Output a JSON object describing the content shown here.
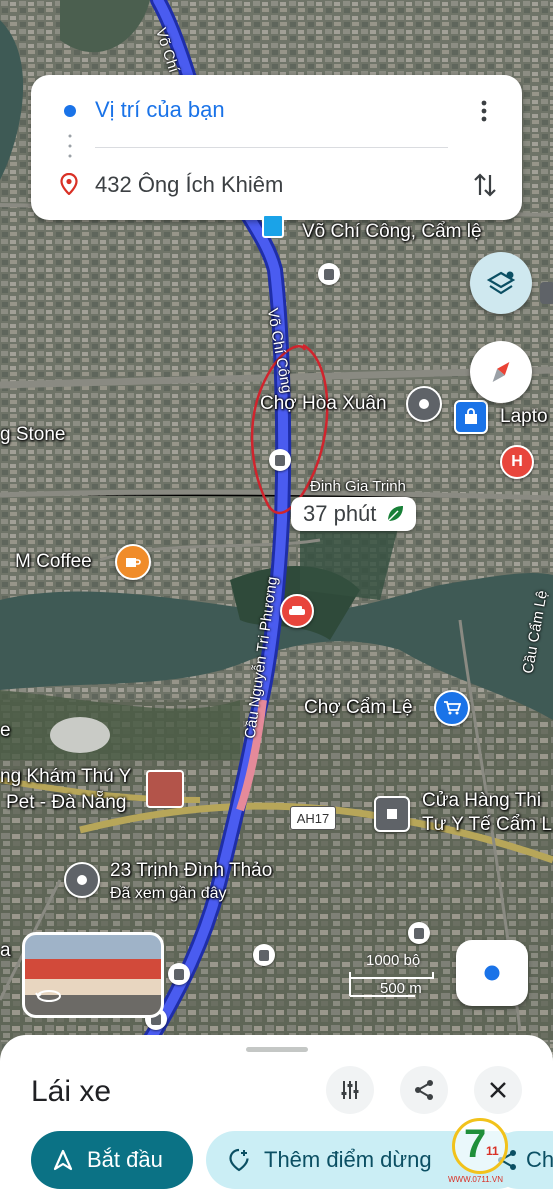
{
  "route_card": {
    "origin": "Vị trí của bạn",
    "destination": "432 Ông Ích Khiêm"
  },
  "map": {
    "labels": {
      "vo_chi_cong_cam_le": "Võ Chí Công, Cẩm lệ",
      "vo_chi_cong_road_top": "Võ Chí Công",
      "vo_chi_cong_road_mid": "Võ Chí Công",
      "cho_hoa_xuan": "Chợ Hòa Xuân",
      "laptop": "Lapto",
      "g_stone": "g Stone",
      "dinh_gia_trinh": "Đinh Gia Trinh",
      "m_coffee": "M Coffee",
      "cau_nguyen_tri_phuong": "Cầu Nguyễn Tri Phương",
      "cau_cam_le": "Cầu Cẩm Lệ",
      "cho_cam_le": "Chợ Cẩm Lệ",
      "kham_thu_y": "ng Khám Thú Y",
      "pet_da_nang": "Pet - Đà Nẵng",
      "ah17": "AH17",
      "cua_hang_line1": "Cửa Hàng Thi",
      "cua_hang_line2": "Tư Y Tế Cẩm L",
      "trinh_dinh_thao": "23 Trịnh Đình Thảo",
      "da_xem": "Đã xem gần đây",
      "left_edge_a": "a",
      "left_edge_e": "e"
    },
    "eta": "37 phút",
    "scale": {
      "feet": "1000 bộ",
      "meters": "500 m"
    },
    "colors": {
      "route": "#4a5cf0",
      "route_outline": "#1f2ea8",
      "annotation": "#d0242d",
      "accent": "#0b7285"
    }
  },
  "sheet": {
    "mode_title": "Lái xe",
    "start_label": "Bắt đầu",
    "add_stop_label": "Thêm điểm dừng",
    "share_label": "Ch"
  },
  "watermark": {
    "number": "7",
    "sub": "11",
    "url": "WWW.0711.VN"
  }
}
